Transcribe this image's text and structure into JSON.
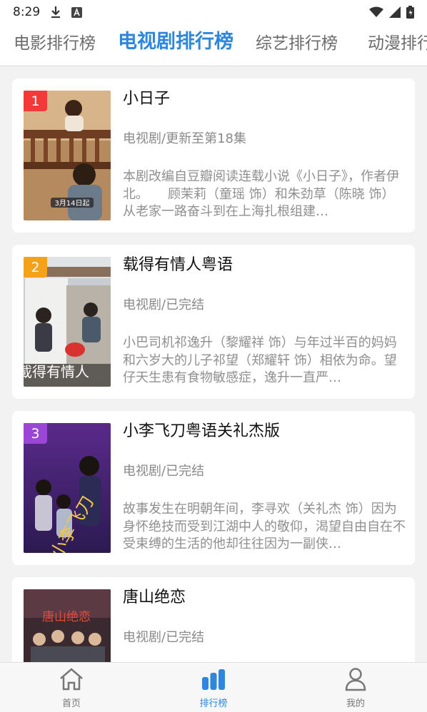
{
  "status": {
    "time": "8:29"
  },
  "tabs": [
    {
      "label": "电影排行榜"
    },
    {
      "label": "电视剧排行榜"
    },
    {
      "label": "综艺排行榜"
    },
    {
      "label": "动漫排行榜"
    }
  ],
  "items": [
    {
      "rank": "1",
      "badge_color": "#f23a3a",
      "title": "小日子",
      "meta": "电视剧/更新至第18集",
      "desc": "本剧改编自豆瓣阅读连载小说《小日子》，作者伊北。　　顾茉莉（童瑶 饰）和朱劲草（陈晓 饰）从老家一路奋斗到在上海扎根组建…",
      "poster_text": "3月14日起"
    },
    {
      "rank": "2",
      "badge_color": "#f5a21b",
      "title": "载得有情人粤语",
      "meta": "电视剧/已完结",
      "desc": "小巴司机祁逸升（黎耀祥 饰）与年过半百的妈妈和六岁大的儿子祁望（郑耀轩 饰）相依为命。望仔天生患有食物敏感症，逸升一直严…",
      "poster_text": "載得有情人"
    },
    {
      "rank": "3",
      "badge_color": "#9a47d8",
      "title": "小李飞刀粤语关礼杰版",
      "meta": "电视剧/已完结",
      "desc": "故事发生在明朝年间，李寻欢（关礼杰 饰）因为身怀绝技而受到江湖中人的敬仰，渴望自由自在不受束缚的生活的他却往往因为一副侠…",
      "poster_text": "小李飞刀"
    },
    {
      "title": "唐山绝恋",
      "meta": "电视剧/已完结",
      "desc": "",
      "poster_text": "唐山绝恋"
    }
  ],
  "bottom_nav": [
    {
      "label": "首页",
      "icon": "home-icon"
    },
    {
      "label": "排行榜",
      "icon": "bar-chart-icon"
    },
    {
      "label": "我的",
      "icon": "user-icon"
    }
  ],
  "colors": {
    "accent": "#2e86de"
  }
}
